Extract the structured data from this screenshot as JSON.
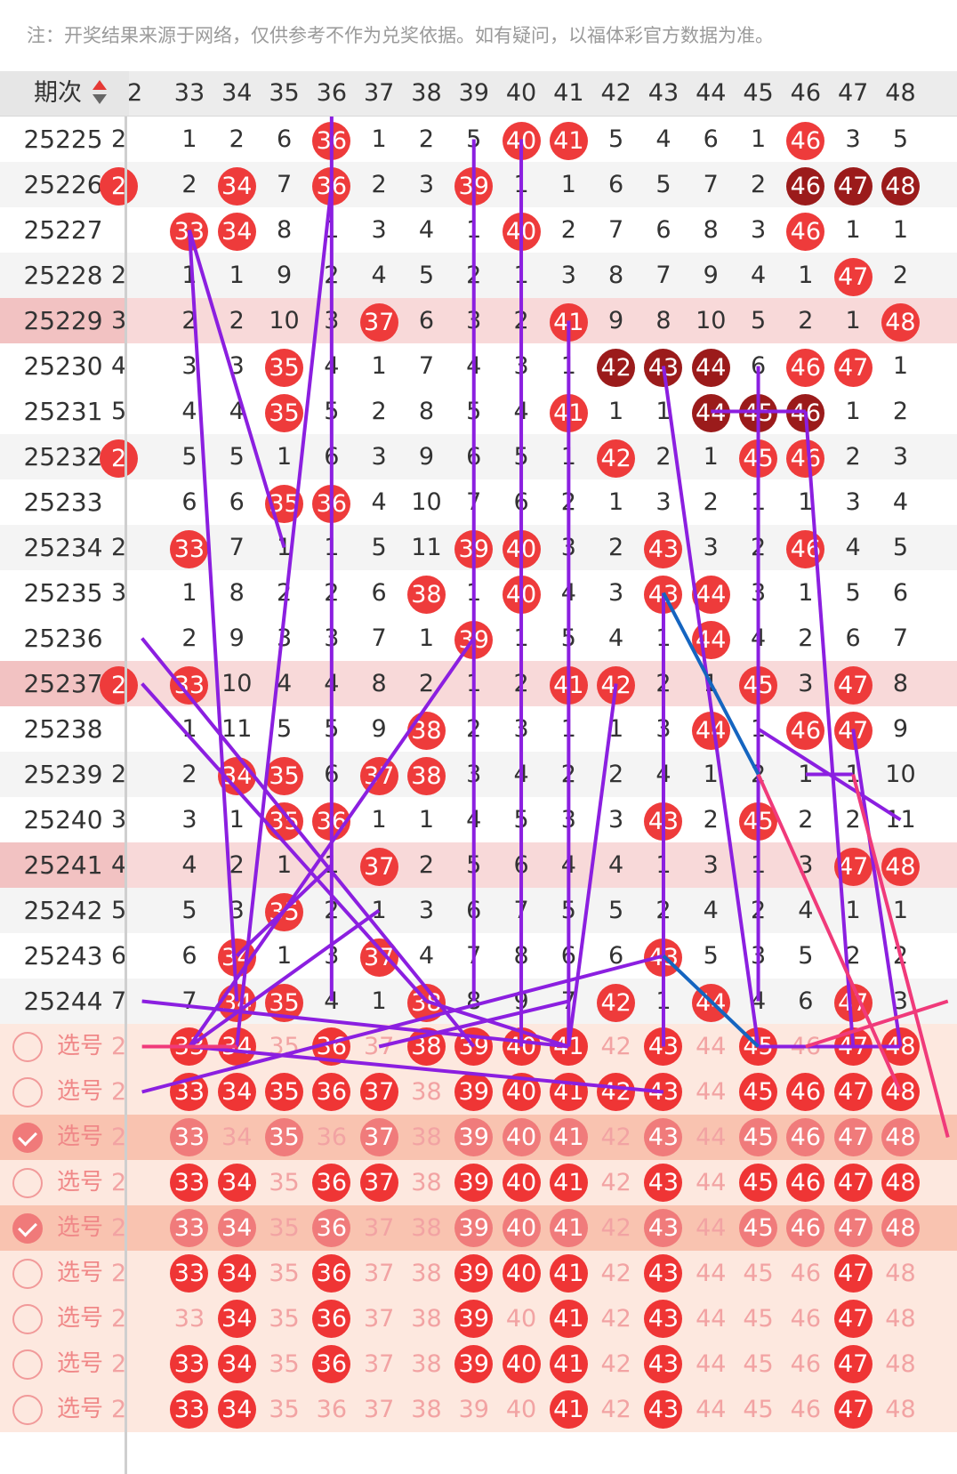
{
  "notice": "注：开奖结果来源于网络，仅供参考不作为兑奖依据。如有疑问，以福体彩官方数据为准。",
  "header": {
    "period_label": "期次",
    "columns": [
      "2",
      "33",
      "34",
      "35",
      "36",
      "37",
      "38",
      "39",
      "40",
      "41",
      "42",
      "43",
      "44",
      "45",
      "46",
      "47",
      "48"
    ]
  },
  "draws": [
    {
      "period": "25225",
      "style": "normal",
      "cells": [
        "2",
        "1",
        "2",
        "6",
        "@36",
        "1",
        "2",
        "5",
        "@40",
        "@41",
        "5",
        "4",
        "6",
        "1",
        "@46",
        "3",
        "5"
      ]
    },
    {
      "period": "25226",
      "style": "alt",
      "cells": [
        "@2",
        "2",
        "@34",
        "7",
        "@36",
        "2",
        "3",
        "@39",
        "1",
        "1",
        "6",
        "5",
        "7",
        "2",
        "#46",
        "#47",
        "#48"
      ]
    },
    {
      "period": "25227",
      "style": "normal",
      "cells": [
        "",
        "@33",
        "@34",
        "8",
        "1",
        "3",
        "4",
        "1",
        "@40",
        "2",
        "7",
        "6",
        "8",
        "3",
        "@46",
        "1",
        "1"
      ]
    },
    {
      "period": "25228",
      "style": "alt",
      "cells": [
        "2",
        "1",
        "1",
        "9",
        "2",
        "4",
        "5",
        "2",
        "1",
        "3",
        "8",
        "7",
        "9",
        "4",
        "1",
        "@47",
        "2"
      ]
    },
    {
      "period": "25229",
      "style": "hl",
      "cells": [
        "3",
        "2",
        "2",
        "10",
        "3",
        "@37",
        "6",
        "3",
        "2",
        "@41",
        "9",
        "8",
        "10",
        "5",
        "2",
        "1",
        "@48"
      ]
    },
    {
      "period": "25230",
      "style": "normal",
      "cells": [
        "4",
        "3",
        "3",
        "@35",
        "4",
        "1",
        "7",
        "4",
        "3",
        "1",
        "#42",
        "#43",
        "#44",
        "6",
        "@46",
        "@47",
        "1"
      ]
    },
    {
      "period": "25231",
      "style": "normal",
      "cells": [
        "5",
        "4",
        "4",
        "@35",
        "5",
        "2",
        "8",
        "5",
        "4",
        "@41",
        "1",
        "1",
        "#44",
        "#45",
        "#46",
        "1",
        "2"
      ]
    },
    {
      "period": "25232",
      "style": "alt",
      "cells": [
        "@2",
        "5",
        "5",
        "1",
        "6",
        "3",
        "9",
        "6",
        "5",
        "1",
        "@42",
        "2",
        "1",
        "@45",
        "@46",
        "2",
        "3"
      ]
    },
    {
      "period": "25233",
      "style": "normal",
      "cells": [
        "",
        "6",
        "6",
        "@35",
        "@36",
        "4",
        "10",
        "7",
        "6",
        "2",
        "1",
        "3",
        "2",
        "1",
        "1",
        "3",
        "4"
      ]
    },
    {
      "period": "25234",
      "style": "alt",
      "cells": [
        "2",
        "@33",
        "7",
        "1",
        "1",
        "5",
        "11",
        "@39",
        "@40",
        "3",
        "2",
        "@43",
        "3",
        "2",
        "@46",
        "4",
        "5"
      ]
    },
    {
      "period": "25235",
      "style": "normal",
      "cells": [
        "3",
        "1",
        "8",
        "2",
        "2",
        "6",
        "@38",
        "1",
        "@40",
        "4",
        "3",
        "@43",
        "@44",
        "3",
        "1",
        "5",
        "6"
      ]
    },
    {
      "period": "25236",
      "style": "normal",
      "cells": [
        "",
        "2",
        "9",
        "3",
        "3",
        "7",
        "1",
        "@39",
        "1",
        "5",
        "4",
        "1",
        "@44",
        "4",
        "2",
        "6",
        "7"
      ]
    },
    {
      "period": "25237",
      "style": "hl",
      "cells": [
        "@2",
        "@33",
        "10",
        "4",
        "4",
        "8",
        "2",
        "1",
        "2",
        "@41",
        "@42",
        "2",
        "1",
        "@45",
        "3",
        "@47",
        "8"
      ]
    },
    {
      "period": "25238",
      "style": "normal",
      "cells": [
        "",
        "1",
        "11",
        "5",
        "5",
        "9",
        "@38",
        "2",
        "3",
        "1",
        "1",
        "3",
        "@44",
        "1",
        "@46",
        "@47",
        "9"
      ]
    },
    {
      "period": "25239",
      "style": "alt",
      "cells": [
        "2",
        "2",
        "@34",
        "@35",
        "6",
        "@37",
        "@38",
        "3",
        "4",
        "2",
        "2",
        "4",
        "1",
        "2",
        "1",
        "1",
        "10"
      ]
    },
    {
      "period": "25240",
      "style": "normal",
      "cells": [
        "3",
        "3",
        "1",
        "@35",
        "@36",
        "1",
        "1",
        "4",
        "5",
        "3",
        "3",
        "@43",
        "2",
        "@45",
        "2",
        "2",
        "11"
      ]
    },
    {
      "period": "25241",
      "style": "hl",
      "cells": [
        "4",
        "4",
        "2",
        "1",
        "1",
        "@37",
        "2",
        "5",
        "6",
        "4",
        "4",
        "1",
        "3",
        "1",
        "3",
        "@47",
        "@48"
      ]
    },
    {
      "period": "25242",
      "style": "alt",
      "cells": [
        "5",
        "5",
        "3",
        "@35",
        "2",
        "1",
        "3",
        "6",
        "7",
        "5",
        "5",
        "2",
        "4",
        "2",
        "4",
        "1",
        "1"
      ]
    },
    {
      "period": "25243",
      "style": "normal",
      "cells": [
        "6",
        "6",
        "@34",
        "1",
        "3",
        "@37",
        "4",
        "7",
        "8",
        "6",
        "6",
        "@43",
        "5",
        "3",
        "5",
        "2",
        "2"
      ]
    },
    {
      "period": "25244",
      "style": "alt",
      "cells": [
        "7",
        "7",
        "@34",
        "@35",
        "4",
        "1",
        "@38",
        "8",
        "9",
        "7",
        "@42",
        "1",
        "@44",
        "4",
        "6",
        "@47",
        "3"
      ]
    }
  ],
  "picker": {
    "label": "选号",
    "rows": [
      {
        "checked": false,
        "balls": [
          "2",
          "@33",
          "@34",
          "35",
          "@36",
          "37",
          "@38",
          "@39",
          "@40",
          "@41",
          "42",
          "@43",
          "44",
          "@45",
          "46",
          "@47",
          "@48"
        ]
      },
      {
        "checked": false,
        "balls": [
          "2",
          "@33",
          "@34",
          "@35",
          "@36",
          "@37",
          "38",
          "@39",
          "@40",
          "@41",
          "@42",
          "@43",
          "44",
          "@45",
          "@46",
          "@47",
          "@48"
        ]
      },
      {
        "checked": true,
        "balls": [
          "2",
          "@33",
          "34",
          "@35",
          "36",
          "@37",
          "38",
          "@39",
          "@40",
          "@41",
          "42",
          "@43",
          "44",
          "@45",
          "@46",
          "@47",
          "@48"
        ]
      },
      {
        "checked": false,
        "balls": [
          "2",
          "@33",
          "@34",
          "35",
          "@36",
          "@37",
          "38",
          "@39",
          "@40",
          "@41",
          "42",
          "@43",
          "44",
          "@45",
          "@46",
          "@47",
          "@48"
        ]
      },
      {
        "checked": true,
        "balls": [
          "2",
          "@33",
          "@34",
          "35",
          "@36",
          "37",
          "38",
          "@39",
          "@40",
          "@41",
          "42",
          "@43",
          "44",
          "@45",
          "@46",
          "@47",
          "@48"
        ]
      },
      {
        "checked": false,
        "balls": [
          "2",
          "@33",
          "@34",
          "35",
          "@36",
          "37",
          "38",
          "@39",
          "@40",
          "@41",
          "42",
          "@43",
          "44",
          "45",
          "46",
          "@47",
          "48"
        ]
      },
      {
        "checked": false,
        "balls": [
          "2",
          "33",
          "@34",
          "35",
          "@36",
          "37",
          "38",
          "@39",
          "40",
          "@41",
          "42",
          "@43",
          "44",
          "45",
          "46",
          "@47",
          "48"
        ]
      },
      {
        "checked": false,
        "balls": [
          "2",
          "@33",
          "@34",
          "35",
          "@36",
          "37",
          "38",
          "@39",
          "@40",
          "@41",
          "42",
          "@43",
          "44",
          "45",
          "46",
          "@47",
          "48"
        ]
      },
      {
        "checked": false,
        "balls": [
          "2",
          "@33",
          "@34",
          "35",
          "36",
          "37",
          "38",
          "39",
          "40",
          "@41",
          "42",
          "@43",
          "44",
          "45",
          "46",
          "@47",
          "48"
        ]
      }
    ]
  },
  "colors": {
    "ball": "#ee3b3b",
    "ball_dark": "#9b1b1b",
    "trend_line": "#8b1fe0",
    "trend_line_pink": "#f03a7a",
    "trend_line_blue": "#1565c0"
  }
}
